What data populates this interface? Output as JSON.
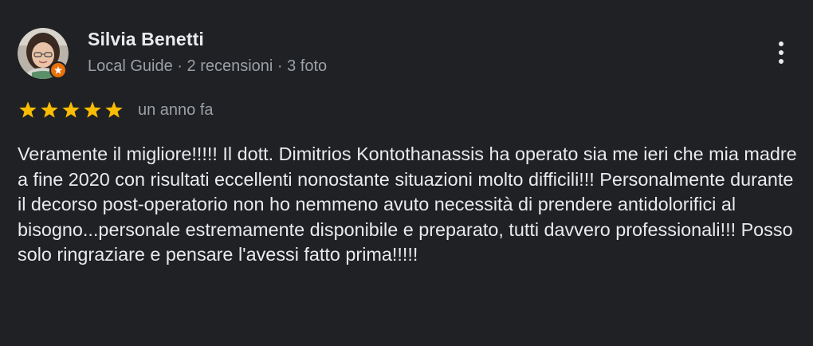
{
  "author": {
    "name": "Silvia Benetti",
    "meta": "Local Guide · 2 recensioni · 3 foto",
    "avatar_icon": "profile-photo",
    "badge_icon": "local-guide-star-icon",
    "badge_color": "#e8710a"
  },
  "review": {
    "rating": 5,
    "rating_max": 5,
    "date": "un anno fa",
    "text": "Veramente il migliore!!!!! Il dott. Dimitrios Kontothanassis ha operato sia me ieri che mia madre a fine 2020 con risultati eccellenti nonostante situazioni molto difficili!!! Personalmente durante il decorso post-operatorio non ho nemmeno avuto necessità di prendere antidolorifici al bisogno...personale estremamente disponibile e preparato, tutti davvero professionali!!! Posso solo ringraziare e pensare l'avessi fatto prima!!!!!"
  },
  "actions": {
    "more_icon": "more-vert-icon"
  },
  "colors": {
    "background": "#202124",
    "text_primary": "#e8eaed",
    "text_secondary": "#9aa0a6",
    "star": "#fbbc04"
  }
}
